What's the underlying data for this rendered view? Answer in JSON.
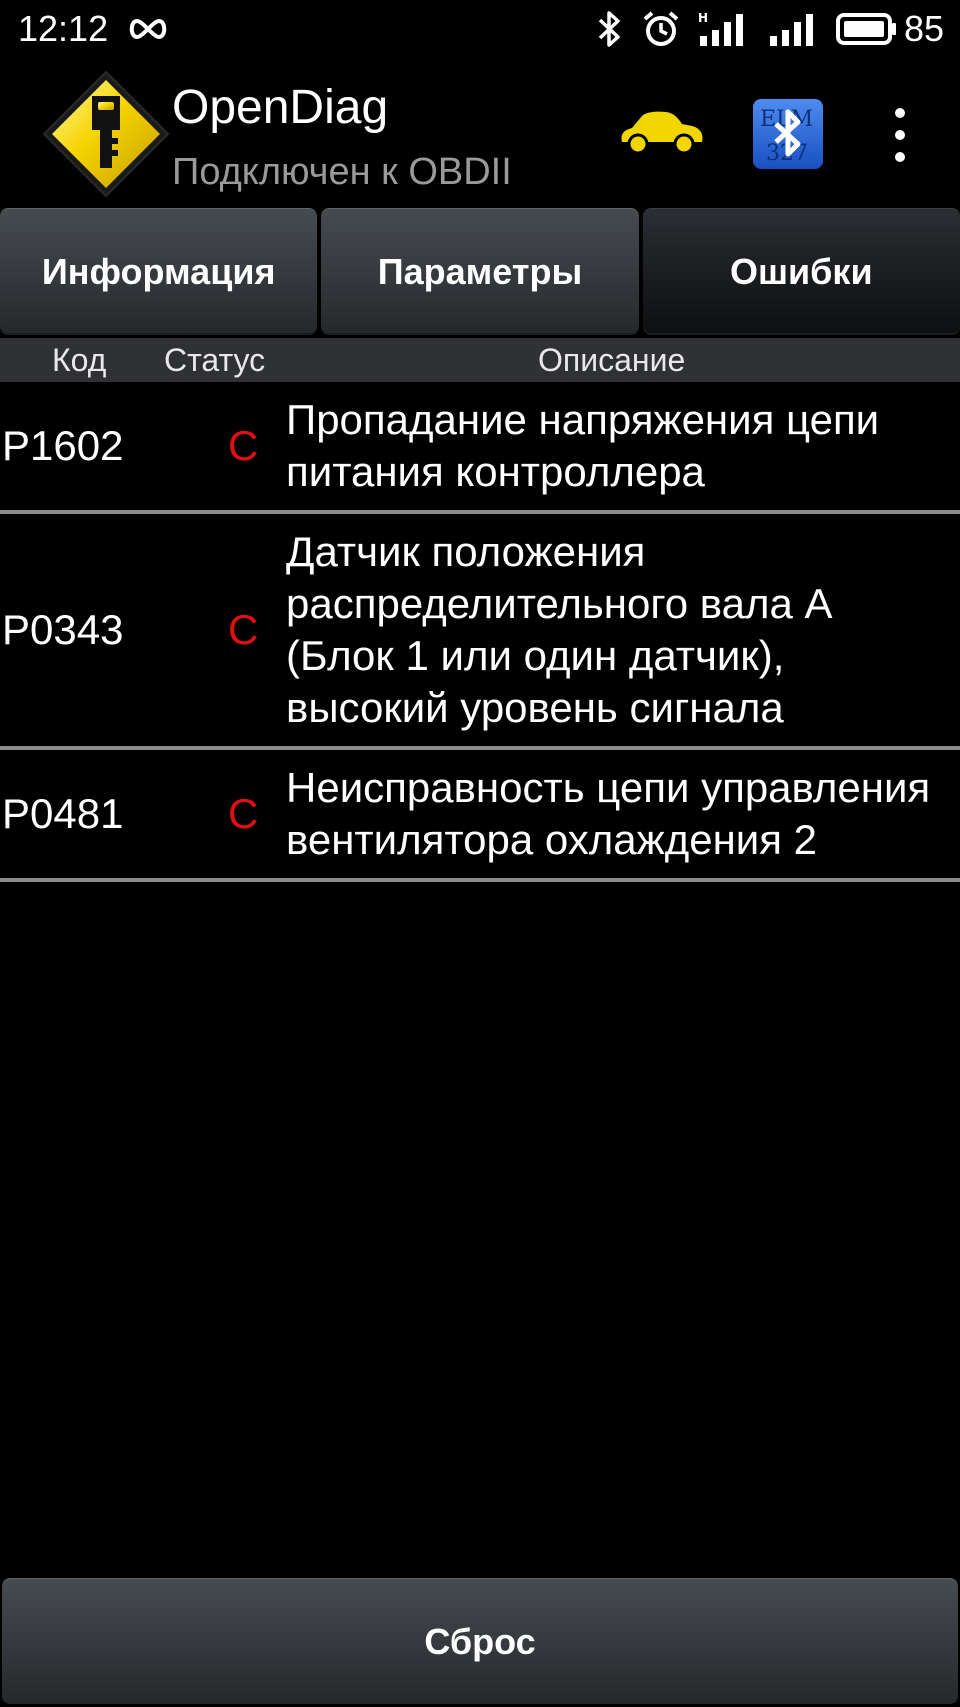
{
  "status_bar": {
    "time": "12:12",
    "battery_level": "85"
  },
  "app": {
    "title": "OpenDiag",
    "subtitle": "Подключен к OBDII"
  },
  "tabs": [
    {
      "label": "Информация",
      "selected": false
    },
    {
      "label": "Параметры",
      "selected": false
    },
    {
      "label": "Ошибки",
      "selected": true
    }
  ],
  "table": {
    "headers": {
      "code": "Код",
      "status": "Статус",
      "description": "Описание"
    },
    "rows": [
      {
        "code": "P1602",
        "status": "C",
        "description": "Пропадание напряжения цепи питания контроллера"
      },
      {
        "code": "P0343",
        "status": "C",
        "description": "Датчик положения распределительного вала А (Блок 1 или один датчик), высокий уровень сигнала"
      },
      {
        "code": "P0481",
        "status": "C",
        "description": "Неисправность цепи управления вентилятора охлаждения 2"
      }
    ]
  },
  "reset_button": {
    "label": "Сброс"
  },
  "icons": {
    "car_color": "#f2d600",
    "logo_color": "#f5d400",
    "status_color": "#e01010"
  }
}
